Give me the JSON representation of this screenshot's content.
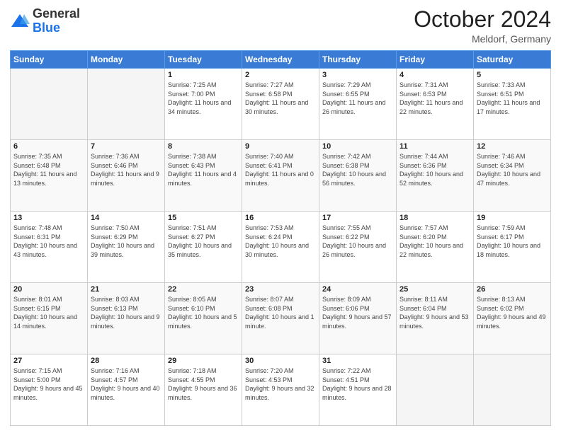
{
  "header": {
    "logo_general": "General",
    "logo_blue": "Blue",
    "month": "October 2024",
    "location": "Meldorf, Germany"
  },
  "weekdays": [
    "Sunday",
    "Monday",
    "Tuesday",
    "Wednesday",
    "Thursday",
    "Friday",
    "Saturday"
  ],
  "weeks": [
    [
      {
        "day": null
      },
      {
        "day": null
      },
      {
        "day": 1,
        "sunrise": "Sunrise: 7:25 AM",
        "sunset": "Sunset: 7:00 PM",
        "daylight": "Daylight: 11 hours and 34 minutes."
      },
      {
        "day": 2,
        "sunrise": "Sunrise: 7:27 AM",
        "sunset": "Sunset: 6:58 PM",
        "daylight": "Daylight: 11 hours and 30 minutes."
      },
      {
        "day": 3,
        "sunrise": "Sunrise: 7:29 AM",
        "sunset": "Sunset: 6:55 PM",
        "daylight": "Daylight: 11 hours and 26 minutes."
      },
      {
        "day": 4,
        "sunrise": "Sunrise: 7:31 AM",
        "sunset": "Sunset: 6:53 PM",
        "daylight": "Daylight: 11 hours and 22 minutes."
      },
      {
        "day": 5,
        "sunrise": "Sunrise: 7:33 AM",
        "sunset": "Sunset: 6:51 PM",
        "daylight": "Daylight: 11 hours and 17 minutes."
      }
    ],
    [
      {
        "day": 6,
        "sunrise": "Sunrise: 7:35 AM",
        "sunset": "Sunset: 6:48 PM",
        "daylight": "Daylight: 11 hours and 13 minutes."
      },
      {
        "day": 7,
        "sunrise": "Sunrise: 7:36 AM",
        "sunset": "Sunset: 6:46 PM",
        "daylight": "Daylight: 11 hours and 9 minutes."
      },
      {
        "day": 8,
        "sunrise": "Sunrise: 7:38 AM",
        "sunset": "Sunset: 6:43 PM",
        "daylight": "Daylight: 11 hours and 4 minutes."
      },
      {
        "day": 9,
        "sunrise": "Sunrise: 7:40 AM",
        "sunset": "Sunset: 6:41 PM",
        "daylight": "Daylight: 11 hours and 0 minutes."
      },
      {
        "day": 10,
        "sunrise": "Sunrise: 7:42 AM",
        "sunset": "Sunset: 6:38 PM",
        "daylight": "Daylight: 10 hours and 56 minutes."
      },
      {
        "day": 11,
        "sunrise": "Sunrise: 7:44 AM",
        "sunset": "Sunset: 6:36 PM",
        "daylight": "Daylight: 10 hours and 52 minutes."
      },
      {
        "day": 12,
        "sunrise": "Sunrise: 7:46 AM",
        "sunset": "Sunset: 6:34 PM",
        "daylight": "Daylight: 10 hours and 47 minutes."
      }
    ],
    [
      {
        "day": 13,
        "sunrise": "Sunrise: 7:48 AM",
        "sunset": "Sunset: 6:31 PM",
        "daylight": "Daylight: 10 hours and 43 minutes."
      },
      {
        "day": 14,
        "sunrise": "Sunrise: 7:50 AM",
        "sunset": "Sunset: 6:29 PM",
        "daylight": "Daylight: 10 hours and 39 minutes."
      },
      {
        "day": 15,
        "sunrise": "Sunrise: 7:51 AM",
        "sunset": "Sunset: 6:27 PM",
        "daylight": "Daylight: 10 hours and 35 minutes."
      },
      {
        "day": 16,
        "sunrise": "Sunrise: 7:53 AM",
        "sunset": "Sunset: 6:24 PM",
        "daylight": "Daylight: 10 hours and 30 minutes."
      },
      {
        "day": 17,
        "sunrise": "Sunrise: 7:55 AM",
        "sunset": "Sunset: 6:22 PM",
        "daylight": "Daylight: 10 hours and 26 minutes."
      },
      {
        "day": 18,
        "sunrise": "Sunrise: 7:57 AM",
        "sunset": "Sunset: 6:20 PM",
        "daylight": "Daylight: 10 hours and 22 minutes."
      },
      {
        "day": 19,
        "sunrise": "Sunrise: 7:59 AM",
        "sunset": "Sunset: 6:17 PM",
        "daylight": "Daylight: 10 hours and 18 minutes."
      }
    ],
    [
      {
        "day": 20,
        "sunrise": "Sunrise: 8:01 AM",
        "sunset": "Sunset: 6:15 PM",
        "daylight": "Daylight: 10 hours and 14 minutes."
      },
      {
        "day": 21,
        "sunrise": "Sunrise: 8:03 AM",
        "sunset": "Sunset: 6:13 PM",
        "daylight": "Daylight: 10 hours and 9 minutes."
      },
      {
        "day": 22,
        "sunrise": "Sunrise: 8:05 AM",
        "sunset": "Sunset: 6:10 PM",
        "daylight": "Daylight: 10 hours and 5 minutes."
      },
      {
        "day": 23,
        "sunrise": "Sunrise: 8:07 AM",
        "sunset": "Sunset: 6:08 PM",
        "daylight": "Daylight: 10 hours and 1 minute."
      },
      {
        "day": 24,
        "sunrise": "Sunrise: 8:09 AM",
        "sunset": "Sunset: 6:06 PM",
        "daylight": "Daylight: 9 hours and 57 minutes."
      },
      {
        "day": 25,
        "sunrise": "Sunrise: 8:11 AM",
        "sunset": "Sunset: 6:04 PM",
        "daylight": "Daylight: 9 hours and 53 minutes."
      },
      {
        "day": 26,
        "sunrise": "Sunrise: 8:13 AM",
        "sunset": "Sunset: 6:02 PM",
        "daylight": "Daylight: 9 hours and 49 minutes."
      }
    ],
    [
      {
        "day": 27,
        "sunrise": "Sunrise: 7:15 AM",
        "sunset": "Sunset: 5:00 PM",
        "daylight": "Daylight: 9 hours and 45 minutes."
      },
      {
        "day": 28,
        "sunrise": "Sunrise: 7:16 AM",
        "sunset": "Sunset: 4:57 PM",
        "daylight": "Daylight: 9 hours and 40 minutes."
      },
      {
        "day": 29,
        "sunrise": "Sunrise: 7:18 AM",
        "sunset": "Sunset: 4:55 PM",
        "daylight": "Daylight: 9 hours and 36 minutes."
      },
      {
        "day": 30,
        "sunrise": "Sunrise: 7:20 AM",
        "sunset": "Sunset: 4:53 PM",
        "daylight": "Daylight: 9 hours and 32 minutes."
      },
      {
        "day": 31,
        "sunrise": "Sunrise: 7:22 AM",
        "sunset": "Sunset: 4:51 PM",
        "daylight": "Daylight: 9 hours and 28 minutes."
      },
      {
        "day": null
      },
      {
        "day": null
      }
    ]
  ]
}
